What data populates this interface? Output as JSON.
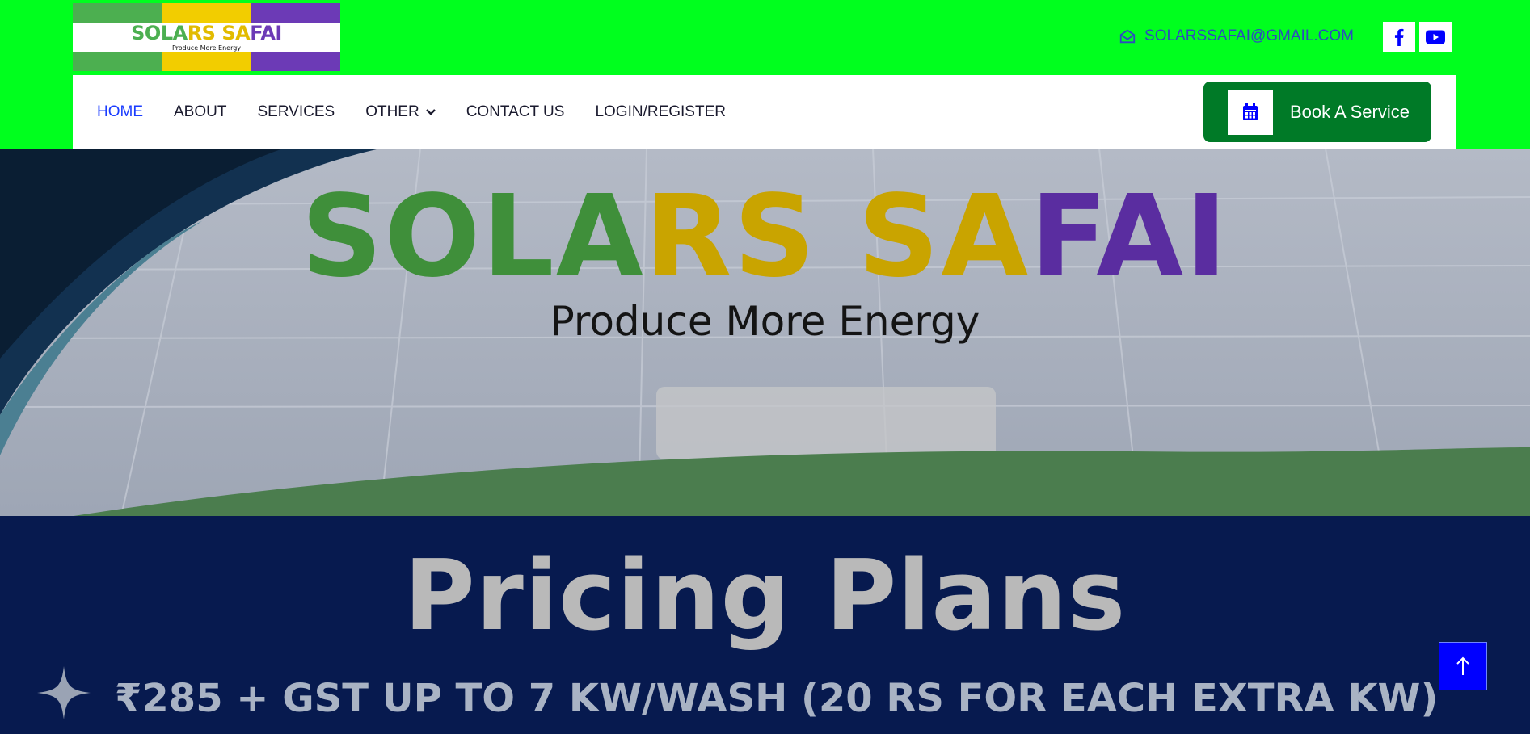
{
  "logo": {
    "word_parts": [
      "SOLA",
      "RS SA",
      "FAI"
    ],
    "tagline": "Produce More Energy",
    "colors": [
      "#4caf50",
      "#f2cd00",
      "#6c3ab6"
    ]
  },
  "topbar": {
    "email": "SOLARSSAFAI@GMAIL.COM",
    "email_icon": "envelope-open-icon",
    "social": [
      "facebook-icon",
      "youtube-icon"
    ],
    "background": "#00ff1e"
  },
  "nav": {
    "items": [
      {
        "label": "HOME",
        "active": true
      },
      {
        "label": "ABOUT"
      },
      {
        "label": "SERVICES"
      },
      {
        "label": "OTHER",
        "dropdown": true
      },
      {
        "label": "CONTACT US"
      },
      {
        "label": "LOGIN/REGISTER"
      }
    ],
    "book_button": {
      "label": "Book A Service",
      "icon": "calendar-icon",
      "color": "#007a27"
    }
  },
  "hero": {
    "brand_parts": [
      "SOLA",
      "RS SA",
      "FAI"
    ],
    "subtitle": "Produce More Energy"
  },
  "pricing": {
    "title": "Pricing Plans",
    "line": "₹285 + GST UP TO 7 KW/WASH (20 RS FOR EACH EXTRA KW)"
  },
  "scroll_top": {
    "icon": "arrow-up-icon"
  }
}
